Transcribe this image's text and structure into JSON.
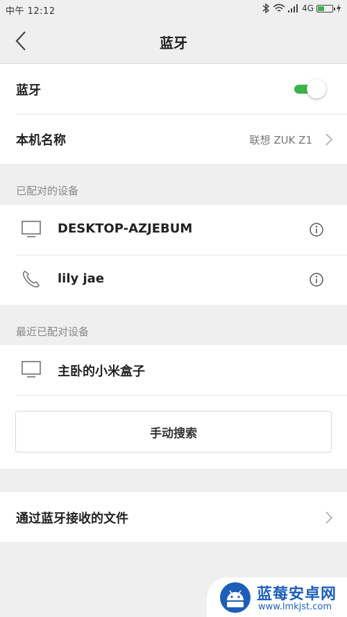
{
  "status_bar": {
    "time": "中午 12:12",
    "network": "4G",
    "battery_level": 0.45
  },
  "header": {
    "title": "蓝牙",
    "back_icon": "back-arrow-icon"
  },
  "bluetooth_row": {
    "label": "蓝牙",
    "enabled": true,
    "accent_color": "#3bb54a"
  },
  "device_name_row": {
    "label": "本机名称",
    "value": "联想 ZUK Z1"
  },
  "paired_section": {
    "header": "已配对的设备",
    "devices": [
      {
        "name": "DESKTOP-AZJEBUM",
        "icon": "monitor-icon"
      },
      {
        "name": "lily jae",
        "icon": "phone-icon"
      }
    ]
  },
  "recent_section": {
    "header": "最近已配对设备",
    "devices": [
      {
        "name": "主卧的小米盒子",
        "icon": "monitor-icon"
      }
    ],
    "search_button": "手动搜索"
  },
  "received_files_row": {
    "label": "通过蓝牙接收的文件"
  },
  "watermark": {
    "title": "蓝莓安卓网",
    "url": "www.lmkjst.com",
    "color": "#1d5fb8"
  }
}
